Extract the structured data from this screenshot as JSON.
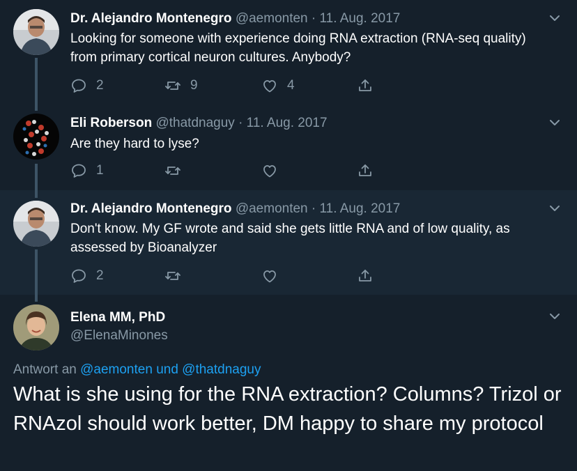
{
  "tweets": [
    {
      "name": "Dr. Alejandro Montenegro",
      "handle": "@aemonten",
      "date": "· 11. Aug. 2017",
      "text": "Looking for someone with experience doing RNA extraction (RNA-seq quality) from primary cortical neuron cultures. Anybody?",
      "replies": "2",
      "retweets": "9",
      "likes": "4"
    },
    {
      "name": "Eli Roberson",
      "handle": "@thatdnaguy",
      "date": "· 11. Aug. 2017",
      "text": "Are they hard to lyse?",
      "replies": "1",
      "retweets": "",
      "likes": ""
    },
    {
      "name": "Dr. Alejandro Montenegro",
      "handle": "@aemonten",
      "date": "· 11. Aug. 2017",
      "text": "Don't know. My GF wrote and said she gets little RNA and of low quality, as assessed by Bioanalyzer",
      "replies": "2",
      "retweets": "",
      "likes": ""
    }
  ],
  "focus": {
    "name": "Elena MM, PhD",
    "handle": "@ElenaMinones",
    "reply_prefix": "Antwort an",
    "reply_user1": "@aemonten",
    "reply_and": "und",
    "reply_user2": "@thatdnaguy",
    "text": "What is she using for the RNA extraction? Columns? Trizol or RNAzol should work better, DM happy to share my protocol"
  },
  "colors": {
    "background": "#15202b",
    "highlight_background": "#192734",
    "secondary_text": "#8899a6",
    "link": "#1da1f2"
  },
  "icons": [
    "reply-icon",
    "retweet-icon",
    "like-icon",
    "share-icon",
    "chevron-down-icon"
  ]
}
